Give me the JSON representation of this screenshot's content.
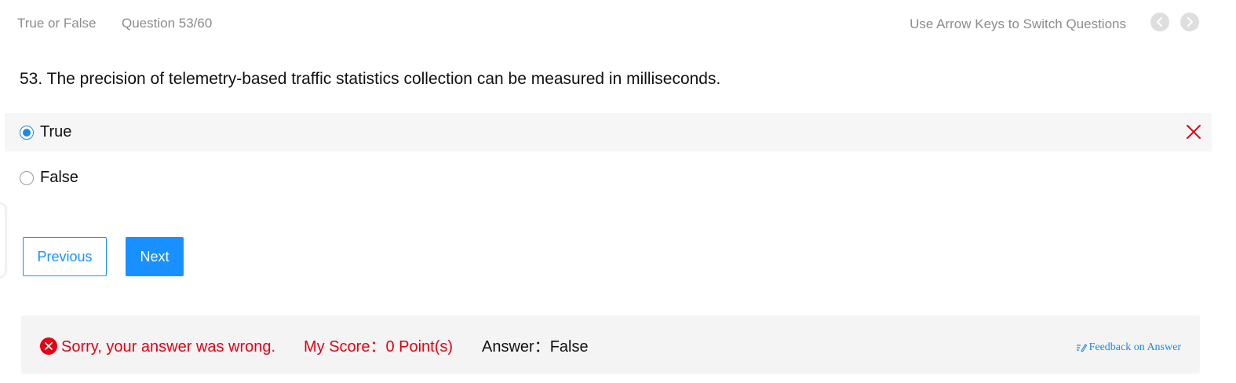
{
  "header": {
    "question_type": "True or False",
    "progress": "Question 53/60",
    "hint": "Use Arrow Keys to Switch Questions",
    "prev_icon": "chevron-left-icon",
    "next_icon": "chevron-right-icon"
  },
  "question": {
    "text": "53. The precision of telemetry-based traffic statistics collection can be measured in milliseconds."
  },
  "options": [
    {
      "label": "True",
      "selected": true,
      "marked_wrong": true
    },
    {
      "label": "False",
      "selected": false,
      "marked_wrong": false
    }
  ],
  "buttons": {
    "previous": "Previous",
    "next": "Next"
  },
  "result": {
    "message": "Sorry, your answer was wrong.",
    "score_label": "My Score：",
    "score_value": "0 Point(s)",
    "answer_label": "Answer：",
    "answer_value": "False",
    "feedback_label": "Feedback on Answer"
  },
  "colors": {
    "accent": "#1890ff",
    "error": "#e60012",
    "muted_text": "#8c8c8c",
    "selected_row_bg": "#f6f6f6",
    "result_bg": "#f4f4f4"
  }
}
